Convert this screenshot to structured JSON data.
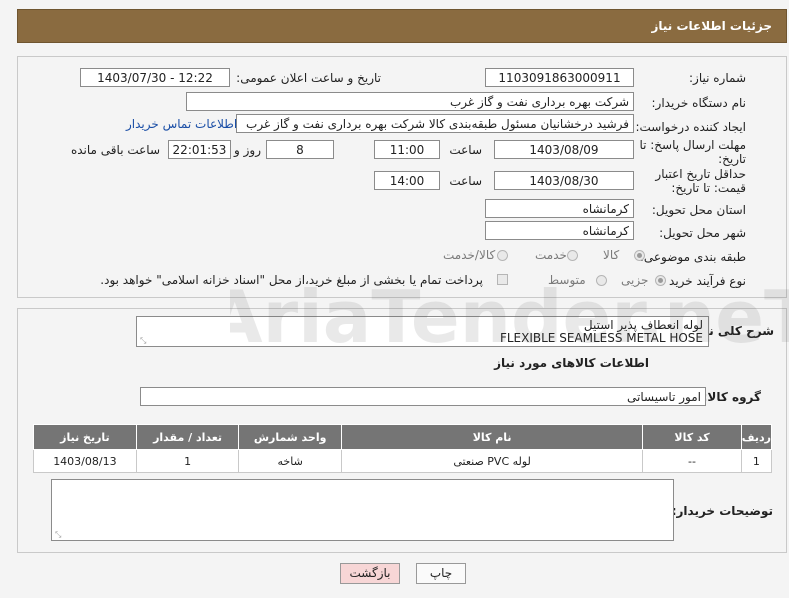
{
  "header": {
    "title": "جزئیات اطلاعات نیاز"
  },
  "need": {
    "need_number_label": "شماره نیاز:",
    "need_number": "1103091863000911",
    "announce_label": "تاریخ و ساعت اعلان عمومی:",
    "announce_value": "1403/07/30 - 12:22",
    "buyer_org_label": "نام دستگاه خریدار:",
    "buyer_org": "شرکت بهره برداری نفت و گاز غرب",
    "creator_label": "ایجاد کننده درخواست:",
    "creator": "فرشید درخشانیان مسئول طبقه‌بندی کالا شرکت بهره برداری نفت و گاز غرب",
    "contact_link": "اطلاعات تماس خریدار",
    "deadline_label": "مهلت ارسال پاسخ: تا تاریخ:",
    "deadline_date": "1403/08/09",
    "time_label": "ساعت",
    "deadline_time": "11:00",
    "days_remaining": "8",
    "day_and_label": "روز و",
    "hours_remaining": "22:01:53",
    "remaining_label": "ساعت باقی مانده",
    "validity_label": "حداقل تاریخ اعتبار قیمت: تا تاریخ:",
    "validity_date": "1403/08/30",
    "validity_time": "14:00",
    "province_label": "استان محل تحویل:",
    "province": "کرمانشاه",
    "city_label": "شهر محل تحویل:",
    "city": "کرمانشاه",
    "category_label": "طبقه بندی موضوعی:",
    "category_options": [
      "کالا",
      "خدمت",
      "کالا/خدمت"
    ],
    "process_label": "نوع فرآیند خرید :",
    "process_options": [
      "جزیی",
      "متوسط"
    ],
    "payment_note": "پرداخت تمام یا بخشی از مبلغ خرید،از محل \"اسناد خزانه اسلامی\" خواهد بود."
  },
  "goods": {
    "summary_label": "شرح کلی نیاز:",
    "summary_line1": "لوله انعطاف پذیر استیل",
    "summary_line2": "FLEXIBLE SEAMLESS METAL HOSE",
    "section_title": "اطلاعات کالاهای مورد نیاز",
    "group_label": "گروه کالا:",
    "group_value": "امور تاسیساتی",
    "table": {
      "headers": [
        "ردیف",
        "کد کالا",
        "نام کالا",
        "واحد شمارش",
        "تعداد / مقدار",
        "تاریخ نیاز"
      ],
      "rows": [
        [
          "1",
          "--",
          "لوله PVC صنعتی",
          "شاخه",
          "1",
          "1403/08/13"
        ]
      ]
    },
    "buyer_notes_label": "توضیحات خریدار:"
  },
  "buttons": {
    "print": "چاپ",
    "back": "بازگشت"
  },
  "watermark": {
    "text": "AriaTender.neT"
  },
  "colors": {
    "header_bg": "#8a6b40",
    "table_header_bg": "#757575",
    "back_button_bg": "#f7d6d6"
  }
}
